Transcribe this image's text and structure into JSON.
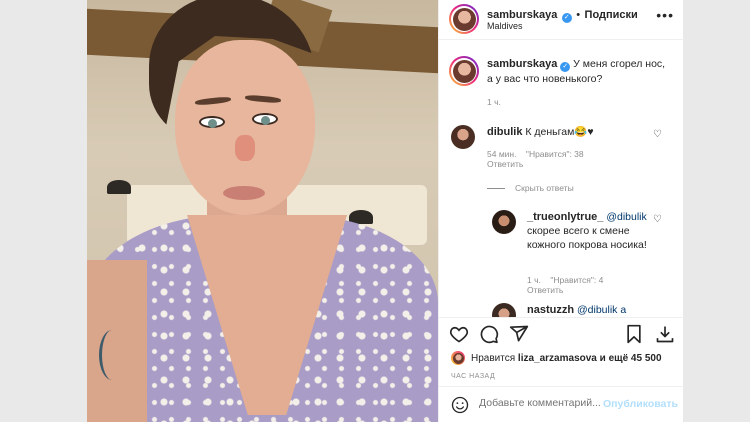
{
  "header": {
    "username": "samburskaya",
    "separator": "•",
    "follow_label": "Подписки",
    "location": "Maldives",
    "more_glyph": "•••"
  },
  "caption": {
    "username": "samburskaya",
    "text": "У меня сгорел нос, а у вас что новенького?",
    "time": "1 ч."
  },
  "comments": [
    {
      "username": "dibulik",
      "text": "К деньгам😂♥",
      "time": "54 мин.",
      "likes": "\"Нравится\": 38",
      "reply_label": "Ответить",
      "hide_replies_label": "Скрыть ответы",
      "replies": [
        {
          "username": "_trueonlytrue_",
          "mention": "@dibulik",
          "text": "скорее всего к смене кожного покрова носика!",
          "time": "1 ч.",
          "likes": "\"Нравится\": 4",
          "reply_label": "Ответить"
        },
        {
          "username": "nastuzzh",
          "mention": "@dibulik а"
        }
      ]
    }
  ],
  "likes_line": {
    "prefix": "Нравится",
    "user": "liza_arzamasova",
    "suffix": "и ещё 45 500"
  },
  "timestamp": "ЧАС НАЗАД",
  "comment_box": {
    "placeholder": "Добавьте комментарий...",
    "publish_label": "Опубликовать"
  },
  "colors": {
    "verified": "#3897f0",
    "publish_disabled": "#b2dffc",
    "mention": "#00376b",
    "story_ring": [
      "#f9ce34",
      "#ee2a7b",
      "#6228d7"
    ]
  },
  "icons": [
    "heart-icon",
    "comment-icon",
    "share-icon",
    "bookmark-icon",
    "download-icon",
    "emoji-icon",
    "more-icon",
    "verified-icon"
  ]
}
